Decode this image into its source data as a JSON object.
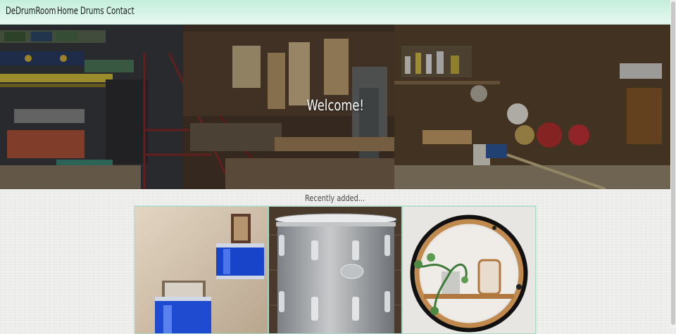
{
  "navbar": {
    "brand": "DeDrumRoom",
    "links": [
      {
        "label": "Home"
      },
      {
        "label": "Drums"
      },
      {
        "label": "Contact"
      }
    ]
  },
  "hero": {
    "heading": "Welcome!",
    "image": "workshop-photo"
  },
  "recent": {
    "heading": "Recently added...",
    "items": [
      {
        "image": "blue-drum-wall-shelves-photo"
      },
      {
        "image": "silver-drum-photo"
      },
      {
        "image": "drum-hoop-plant-shelf-photo"
      }
    ]
  },
  "colors": {
    "navbar_gradient_top": "#c4efdc",
    "navbar_gradient_bottom": "#e6f8f0",
    "card_border": "#a9dcc5",
    "page_background": "#ececeb"
  }
}
